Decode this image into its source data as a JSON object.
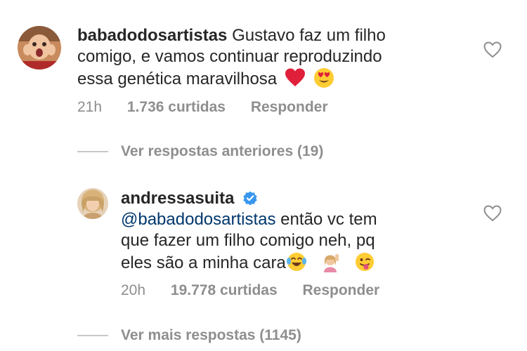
{
  "comments": [
    {
      "username": "babadodosartistas",
      "text_lines": [
        "Gustavo faz um filho",
        "comigo, e vamos continuar reproduzindo",
        "essa genética maravilhosa"
      ],
      "time": "21h",
      "likes": "1.736 curtidas",
      "reply_label": "Responder"
    },
    {
      "username": "andressasuita",
      "mention": "@babadodosartistas",
      "text_lines": [
        "então vc tem",
        "que fazer um filho comigo neh, pq",
        "eles são a minha cara"
      ],
      "time": "20h",
      "likes": "19.778 curtidas",
      "reply_label": "Responder"
    }
  ],
  "thread": {
    "previous_replies": "Ver respostas anteriores (19)",
    "more_replies": "Ver mais respostas (1145)"
  },
  "icons": {
    "heart_outline": "heart-outline-icon",
    "verified": "verified-badge-icon",
    "emoji_heart": "red-heart-emoji",
    "emoji_heart_eyes": "heart-eyes-emoji",
    "emoji_joy": "tears-of-joy-emoji",
    "emoji_tipping_hand": "tipping-hand-emoji",
    "emoji_wink_tongue": "winking-tongue-emoji"
  },
  "colors": {
    "text": "#262626",
    "muted": "#8e8e8e",
    "mention": "#00376b",
    "verified": "#3897f0"
  }
}
